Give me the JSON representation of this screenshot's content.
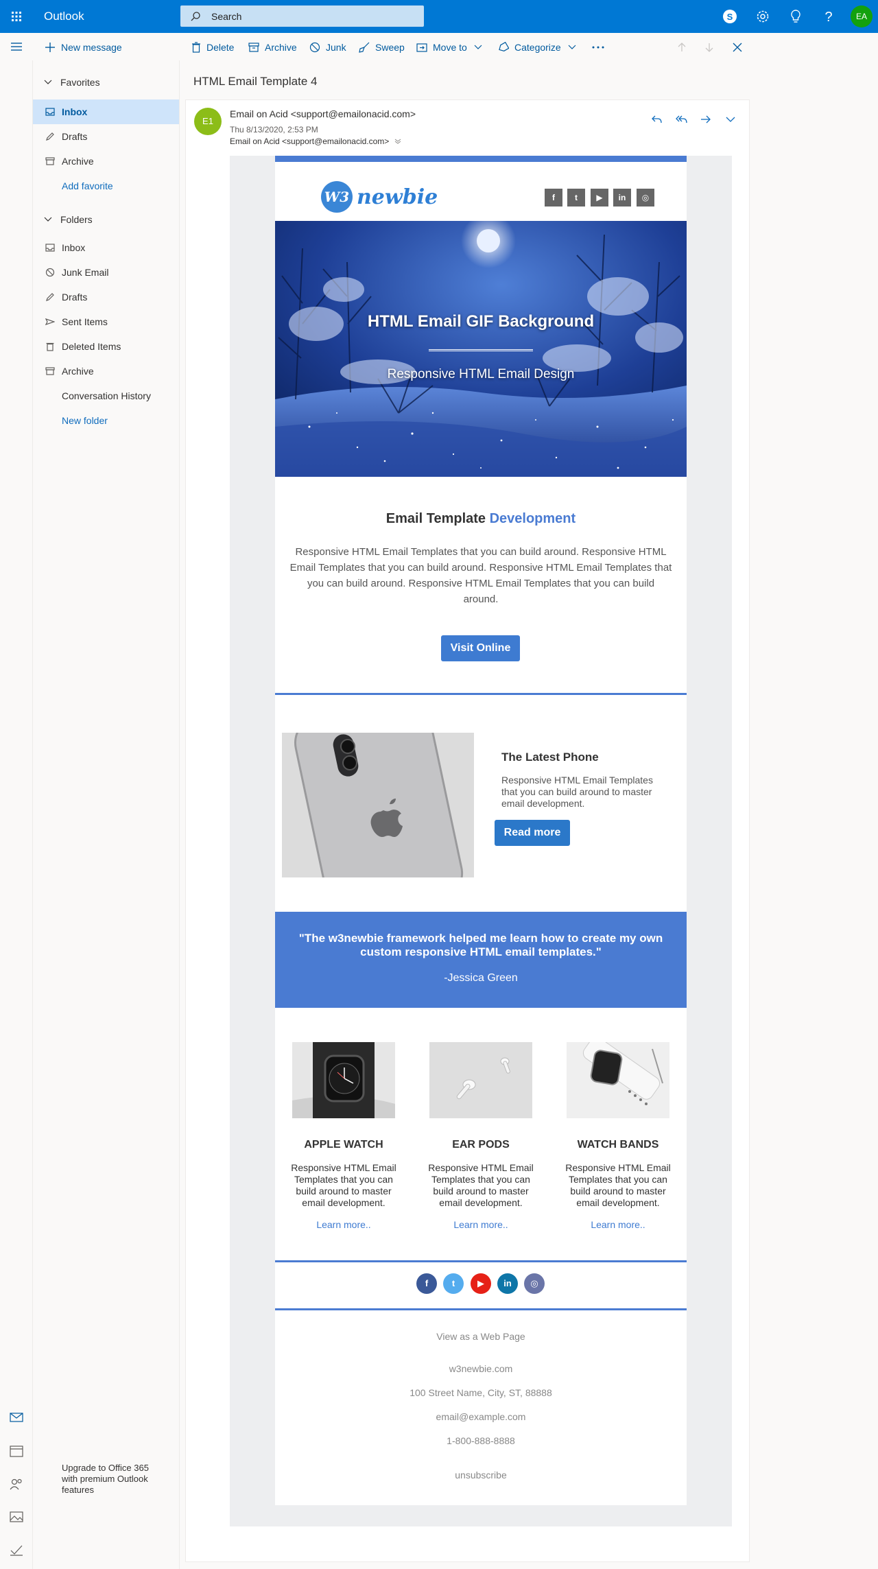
{
  "app": {
    "name": "Outlook"
  },
  "search": {
    "placeholder": "Search"
  },
  "user": {
    "initials": "EA"
  },
  "colors": {
    "brand": "#0078d4",
    "accent": "#4a7bd2",
    "selected": "#cfe4fa"
  },
  "commands": {
    "new_message": "New message",
    "delete": "Delete",
    "archive": "Archive",
    "junk": "Junk",
    "sweep": "Sweep",
    "move_to": "Move to",
    "categorize": "Categorize"
  },
  "favorites": {
    "header": "Favorites",
    "items": [
      "Inbox",
      "Drafts",
      "Archive"
    ],
    "add": "Add favorite"
  },
  "folders": {
    "header": "Folders",
    "items": [
      "Inbox",
      "Junk Email",
      "Drafts",
      "Sent Items",
      "Deleted Items",
      "Archive",
      "Conversation History"
    ],
    "new": "New folder"
  },
  "upgrade": "Upgrade to Office 365 with premium Outlook features",
  "message": {
    "subject": "HTML Email Template 4",
    "avatar": "E1",
    "from": "Email on Acid <support@emailonacid.com>",
    "date": "Thu 8/13/2020, 2:53 PM",
    "to": "Email on Acid <support@emailonacid.com>"
  },
  "email": {
    "logo_mark": "W3",
    "logo_text": "newbie",
    "social_top": [
      "f",
      "t",
      "▶",
      "in",
      "◎"
    ],
    "hero": {
      "title": "HTML Email GIF Background",
      "subtitle": "Responsive HTML Email Design"
    },
    "intro": {
      "title_a": "Email Template",
      "title_b": "Development",
      "text": "Responsive HTML Email Templates that you can build around. Responsive HTML Email Templates that you can build around. Responsive HTML Email Templates that you can build around. Responsive HTML Email Templates that you can build around.",
      "button": "Visit Online"
    },
    "feature": {
      "title": "The Latest Phone",
      "text": "Responsive HTML Email Templates that you can build around to master email development.",
      "button": "Read more"
    },
    "quote": {
      "text": "\"The w3newbie framework helped me learn how to create my own custom responsive HTML email templates.\"",
      "author": "-Jessica Green"
    },
    "products": [
      {
        "title": "APPLE WATCH",
        "text": "Responsive HTML Email Templates that you can build around to master email development.",
        "link": "Learn more.."
      },
      {
        "title": "EAR PODS",
        "text": "Responsive HTML Email Templates that you can build around to master email development.",
        "link": "Learn more.."
      },
      {
        "title": "WATCH BANDS",
        "text": "Responsive HTML Email Templates that you can build around to master email development.",
        "link": "Learn more.."
      }
    ],
    "social_bottom": [
      "f",
      "t",
      "▶",
      "in",
      "◎"
    ],
    "footer": {
      "web": "View as a Web Page",
      "site": "w3newbie.com",
      "address": "100 Street Name, City, ST, 88888",
      "email": "email@example.com",
      "phone": "1-800-888-8888",
      "unsubscribe": "unsubscribe"
    }
  }
}
